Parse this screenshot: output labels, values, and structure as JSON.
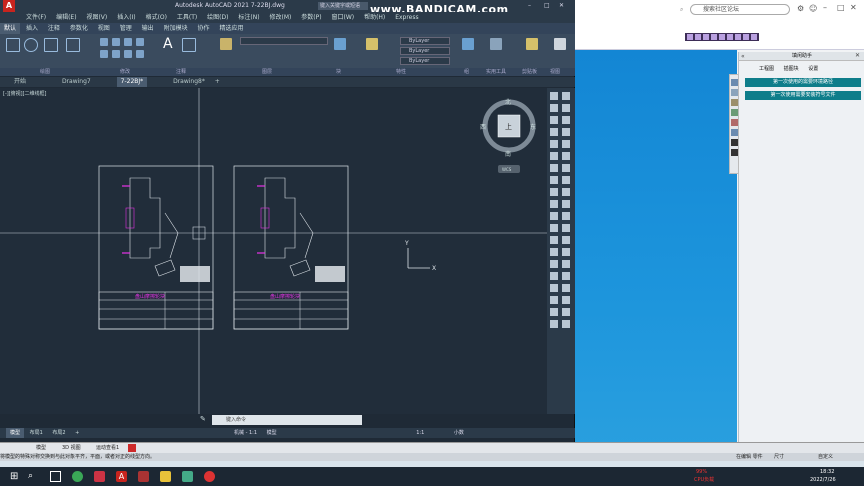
{
  "cad": {
    "title": "Autodesk AutoCAD 2021   7-22BJ.dwg",
    "search_placeholder": "键入关键字或短语",
    "menus": [
      "文件(F)",
      "编辑(E)",
      "视图(V)",
      "插入(I)",
      "格式(O)",
      "工具(T)",
      "绘图(D)",
      "标注(N)",
      "修改(M)",
      "参数(P)",
      "窗口(W)",
      "帮助(H)",
      "Express"
    ],
    "ribbon_tabs": [
      "默认",
      "插入",
      "注释",
      "参数化",
      "视图",
      "管理",
      "输出",
      "附加模块",
      "协作",
      "精选应用"
    ],
    "ribbon_groups": [
      "绘图",
      "修改",
      "注释",
      "图层",
      "块",
      "特性",
      "组",
      "实用工具",
      "剪贴板",
      "视图"
    ],
    "bylayer": "ByLayer",
    "doc_tabs": [
      "开始",
      "Drawing7",
      "7-22BJ*",
      "Drawing8*"
    ],
    "viewport_label": "[-][俯视][二维线框]",
    "compass": {
      "n": "北",
      "s": "南",
      "e": "东",
      "w": "西",
      "top": "上",
      "wcs": "WCS"
    },
    "ucs": {
      "x": "X",
      "y": "Y"
    },
    "layout_tabs": [
      "模型",
      "布局1",
      "布局2"
    ],
    "status": [
      "机械 - 1:1",
      "模型",
      "1:1",
      "小数"
    ],
    "cmd_placeholder": "键入命令",
    "drawing_title": "盘山摩擦轮块"
  },
  "browser": {
    "search_placeholder": "搜索社区论坛",
    "panel_title": "填闲助手",
    "panel_tabs": [
      "工程图",
      "插图块",
      "设置"
    ],
    "panel_buttons": [
      "第一次使用的需要环境路径",
      "第一次使用需要安装符号文件"
    ]
  },
  "bandicam": "www.BANDICAM.com",
  "desktop": {
    "status_line": "将模型的特殊对称交换到与此对象平齐，平面，或者对正的线型方向。",
    "layout_row": [
      "模型",
      "3D 视图",
      "运动查看1"
    ],
    "right_info": [
      "在编辑 零件",
      "尺寸",
      "自定义"
    ],
    "time": "18:32",
    "date": "2022/7/26",
    "cpu": "99%",
    "cpu_label": "CPU负载"
  },
  "colors": {
    "magenta": "#e033e0",
    "accent": "#0e7d8a",
    "canvas": "#212d3a"
  }
}
